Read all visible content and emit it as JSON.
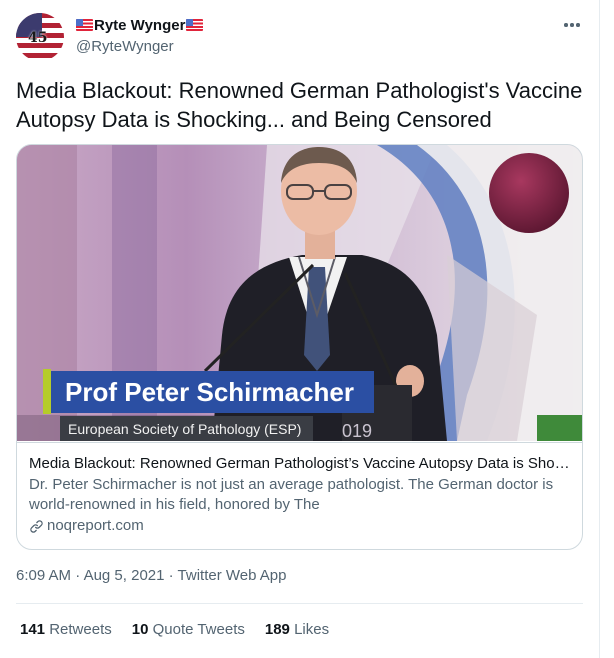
{
  "user": {
    "display_name": "Ryte Wynger",
    "handle": "@RyteWynger",
    "avatar_badge": "45"
  },
  "tweet": {
    "text": "Media Blackout: Renowned German Pathologist's Vaccine Autopsy Data is Shocking... and Being Censored"
  },
  "card": {
    "overlay_name": "Prof Peter Schirmacher",
    "overlay_org": "European Society of Pathology (ESP)",
    "title": "Media Blackout: Renowned German Pathologist’s Vaccine Autopsy Data is Shocking... and Being Censored",
    "description": "Dr. Peter Schirmacher is not just an average pathologist. The German doctor is world-renowned in his field, honored by The",
    "domain": "noqreport.com"
  },
  "meta": {
    "time": "6:09 AM",
    "separator_1": " · ",
    "date": "Aug 5, 2021",
    "separator_2": " · ",
    "source": "Twitter Web App"
  },
  "stats": {
    "retweets_count": "141",
    "retweets_label": "Retweets",
    "quotes_count": "10",
    "quotes_label": "Quote Tweets",
    "likes_count": "189",
    "likes_label": "Likes"
  },
  "colors": {
    "text_primary": "#0f1419",
    "text_secondary": "#536471",
    "border": "#cfd9de",
    "overlay_blue": "#2b4fa3",
    "overlay_accent": "#b5cc2a"
  }
}
